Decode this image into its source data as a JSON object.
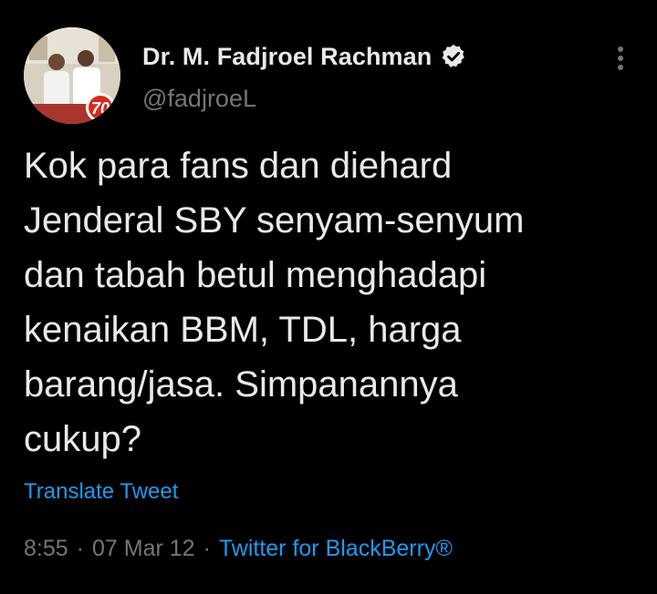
{
  "author": {
    "display_name": "Dr. M. Fadjroel Rachman",
    "handle": "@fadjroeL",
    "verified": true,
    "avatar_badge": "70"
  },
  "tweet": {
    "text": "Kok para fans dan diehard\nJenderal SBY senyam-senyum\ndan tabah betul menghadapi\nkenaikan BBM, TDL, harga\nbarang/jasa. Simpanannya\ncukup?",
    "translate_label": "Translate Tweet",
    "time": "8:55",
    "separator": "·",
    "date": "07 Mar 12",
    "source": "Twitter for BlackBerry®"
  },
  "icons": {
    "verified": "verified-badge-icon",
    "more": "more-vertical-icon"
  },
  "colors": {
    "background": "#000000",
    "text_primary": "#e7e9ea",
    "text_secondary": "#71767b",
    "link": "#1d9bf0"
  }
}
